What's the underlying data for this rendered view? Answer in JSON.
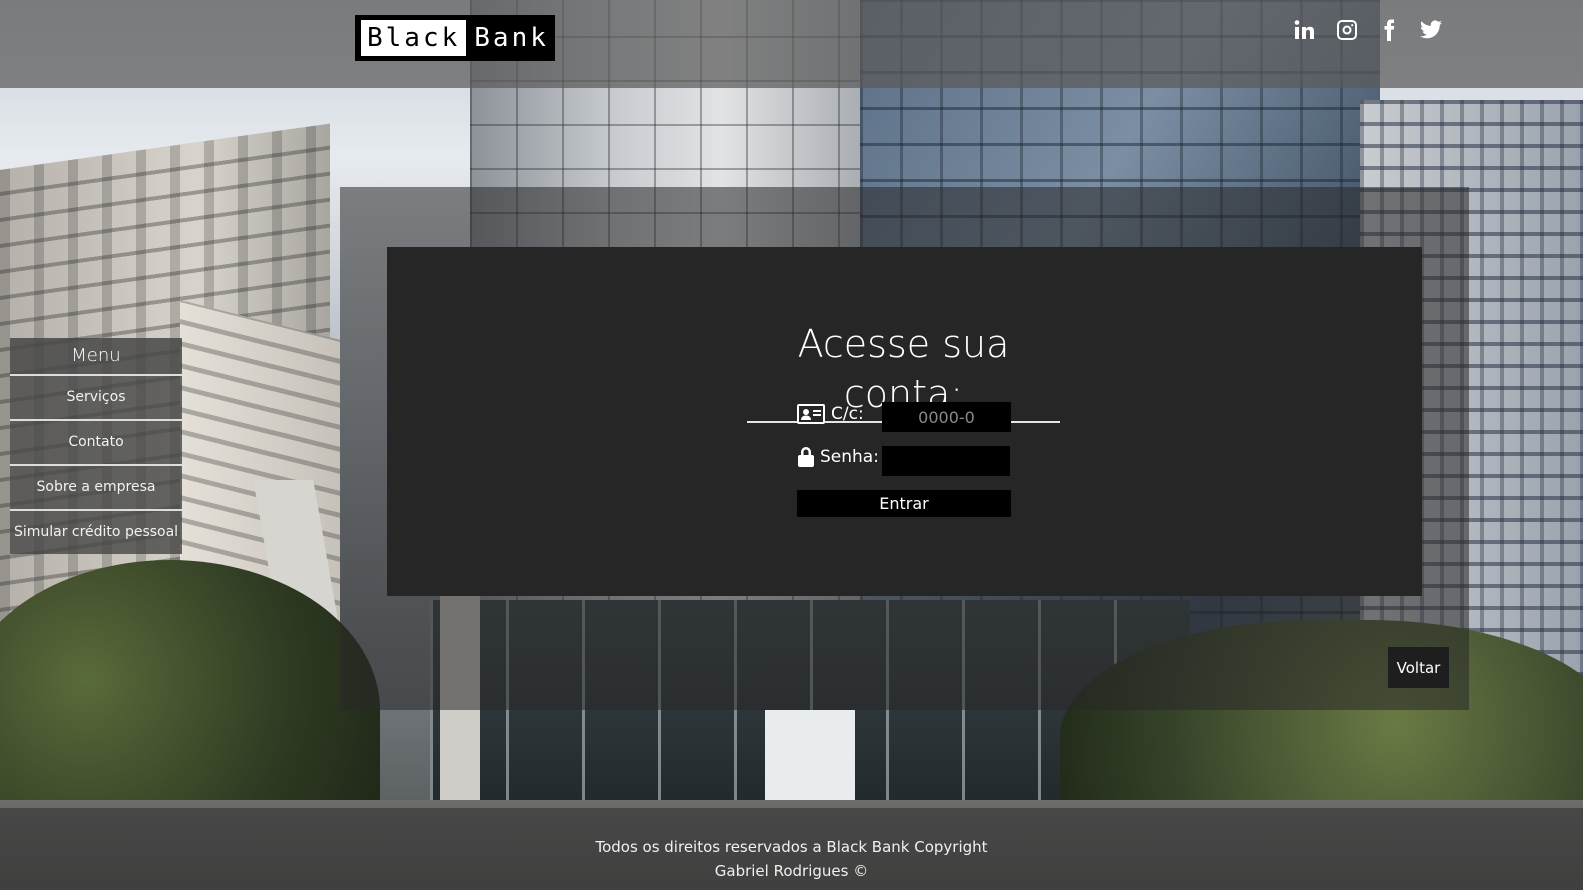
{
  "brand": {
    "part1": "Black",
    "part2": "Bank"
  },
  "social": [
    {
      "name": "linkedin-icon"
    },
    {
      "name": "instagram-icon"
    },
    {
      "name": "facebook-icon"
    },
    {
      "name": "twitter-icon"
    }
  ],
  "menu": {
    "title": "Menu",
    "items": [
      {
        "label": "Serviços"
      },
      {
        "label": "Contato"
      },
      {
        "label": "Sobre a empresa"
      },
      {
        "label": "Simular crédito pessoal"
      }
    ]
  },
  "login": {
    "title": "Acesse sua conta:",
    "account_label": "C/c:",
    "account_placeholder": "0000-0",
    "password_label": "Senha:",
    "submit_label": "Entrar"
  },
  "back_label": "Voltar",
  "footer": {
    "line1": "Todos os direitos reservados a Black Bank Copyright",
    "line2": "Gabriel Rodrigues ©"
  },
  "colors": {
    "panel": "#262626",
    "input": "#000000",
    "text": "#ffffff"
  }
}
